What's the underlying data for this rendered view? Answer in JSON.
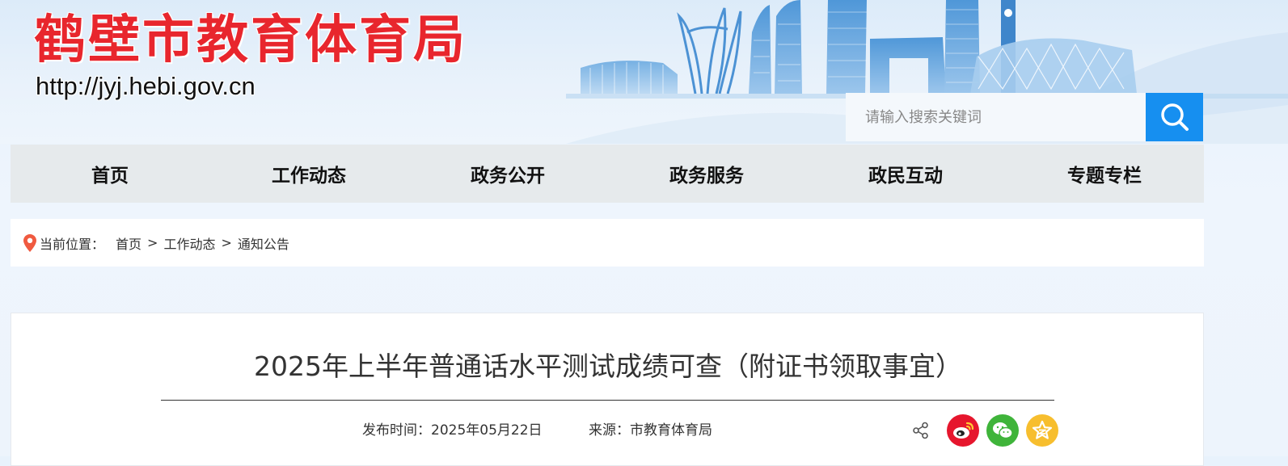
{
  "header": {
    "site_name": "鹤壁市教育体育局",
    "site_url": "http://jyj.hebi.gov.cn"
  },
  "search": {
    "placeholder": "请输入搜索关键词",
    "value": ""
  },
  "nav": {
    "items": [
      {
        "label": "首页"
      },
      {
        "label": "工作动态"
      },
      {
        "label": "政务公开"
      },
      {
        "label": "政务服务"
      },
      {
        "label": "政民互动"
      },
      {
        "label": "专题专栏"
      }
    ]
  },
  "breadcrumb": {
    "label": "当前位置：",
    "items": [
      "首页",
      "工作动态",
      "通知公告"
    ],
    "separator": ">"
  },
  "article": {
    "title": "2025年上半年普通话水平测试成绩可查（附证书领取事宜）",
    "date": "发布时间：2025年05月22日",
    "source": "来源：市教育体育局"
  },
  "share": {
    "icons": [
      "share-icon",
      "weibo-icon",
      "wechat-icon",
      "qzone-icon"
    ]
  },
  "colors": {
    "brand_red": "#e8262d",
    "search_blue": "#168ff0",
    "nav_bg": "#e6eaec",
    "weibo_red": "#e6162d",
    "wechat_green": "#3fb43a",
    "qzone_yellow": "#f7be2e"
  }
}
